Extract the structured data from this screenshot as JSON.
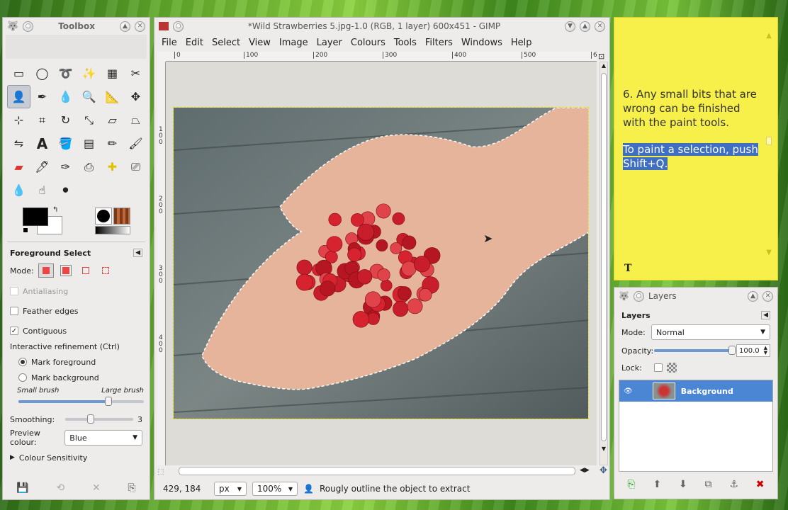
{
  "toolbox": {
    "title": "Toolbox",
    "tool_options_title": "Foreground Select",
    "mode_label": "Mode:",
    "antialiasing": "Antialiasing",
    "feather_edges": "Feather edges",
    "contiguous": "Contiguous",
    "refinement_label": "Interactive refinement  (Ctrl)",
    "mark_foreground": "Mark foreground",
    "mark_background": "Mark background",
    "small_brush": "Small brush",
    "large_brush": "Large brush",
    "brush_level": 0.72,
    "smoothing_label": "Smoothing:",
    "smoothing_value": "3",
    "smoothing_level": 0.37,
    "preview_label": "Preview colour:",
    "preview_value": "Blue",
    "colour_sensitivity": "Colour Sensitivity"
  },
  "image_window": {
    "title": "*Wild Strawberries 5.jpg-1.0 (RGB, 1 layer) 600x451 - GIMP",
    "menu": [
      "File",
      "Edit",
      "Select",
      "View",
      "Image",
      "Layer",
      "Colours",
      "Tools",
      "Filters",
      "Windows",
      "Help"
    ],
    "ruler_h": [
      "0",
      "100",
      "200",
      "300",
      "400",
      "500",
      "6"
    ],
    "ruler_v": [
      "1",
      "0",
      "0",
      "2",
      "0",
      "0",
      "3",
      "0",
      "0",
      "4",
      "0",
      "0"
    ],
    "coords": "429, 184",
    "unit": "px",
    "zoom": "100%",
    "status": "Rougly outline the object to extract"
  },
  "note": {
    "text1": "6. Any small bits that are wrong can be finished with the paint tools.",
    "text2": "To paint a selection, push Shift+Q.",
    "icon": "T"
  },
  "layers": {
    "title": "Layers",
    "tab_label": "Layers",
    "mode_label": "Mode:",
    "mode_value": "Normal",
    "opacity_label": "Opacity:",
    "opacity_value": "100.0",
    "opacity_level": 1.0,
    "lock_label": "Lock:",
    "layer_name": "Background"
  },
  "colors": {
    "accent": "#4a86d4",
    "note_yellow": "#f7ef4a",
    "selection_highlight": "#3f6fc2"
  }
}
